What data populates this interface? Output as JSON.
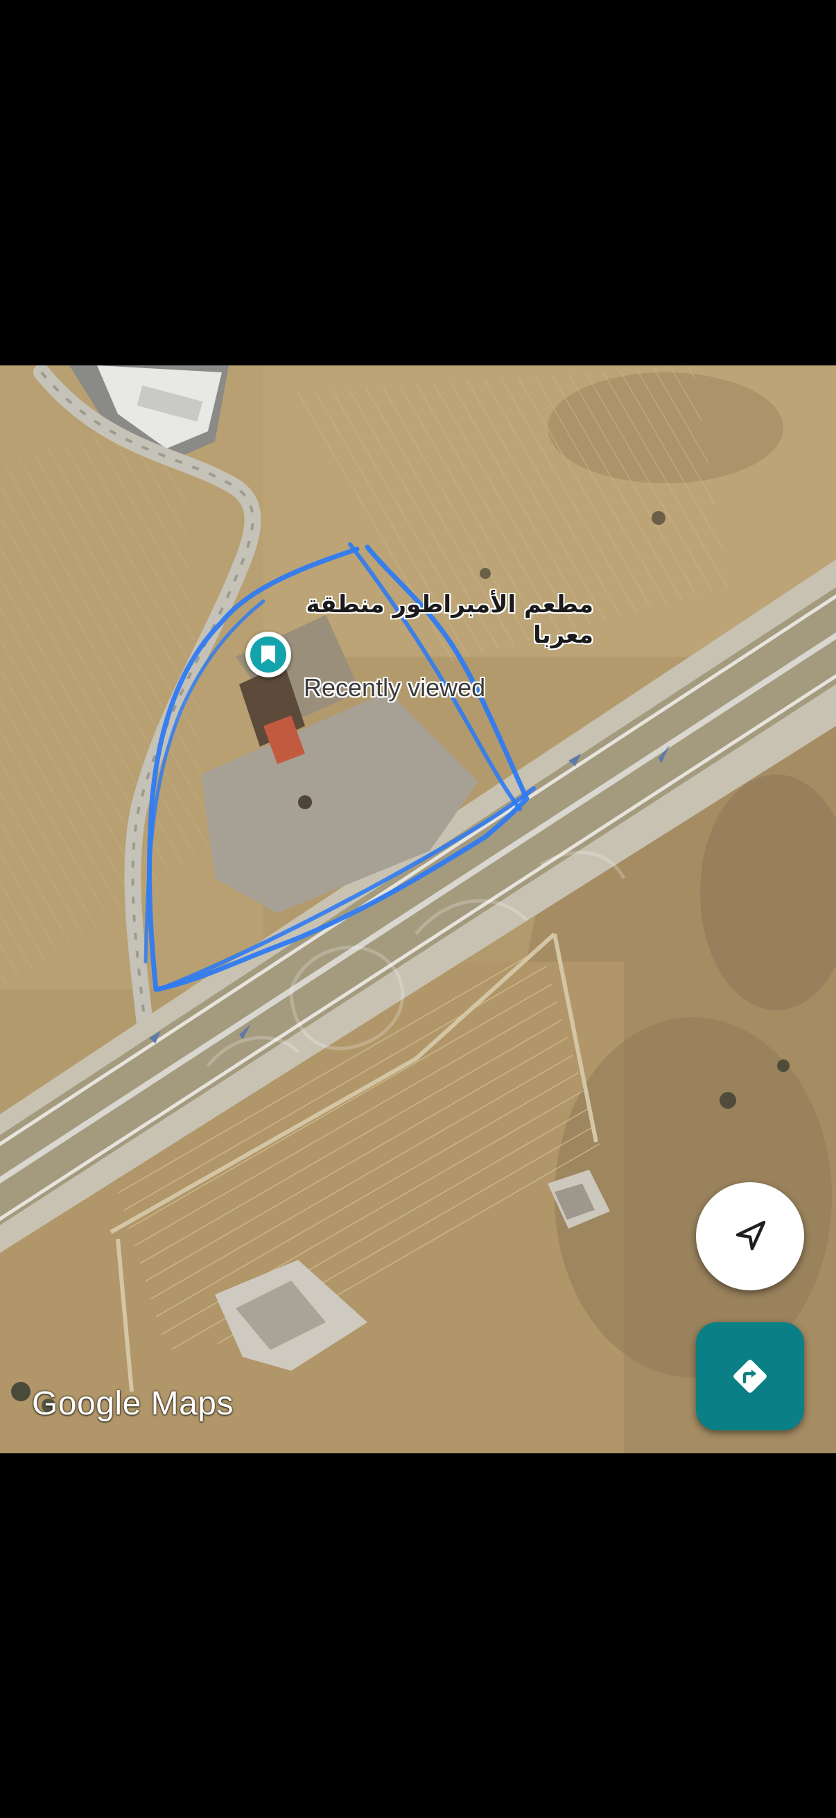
{
  "map": {
    "view": "satellite",
    "place": {
      "name": "مطعم الأمبراطور منطقة معربا",
      "status": "Recently viewed",
      "marker_icon": "bookmark-icon",
      "marker_color": "#13a3ad"
    },
    "annotation": {
      "type": "hand-drawn-outline",
      "color": "#2f7bf2"
    },
    "attribution": "Google Maps"
  },
  "controls": {
    "my_location_icon": "navigation-arrow-icon",
    "directions_icon": "directions-icon",
    "directions_color": "#0b7f86"
  }
}
